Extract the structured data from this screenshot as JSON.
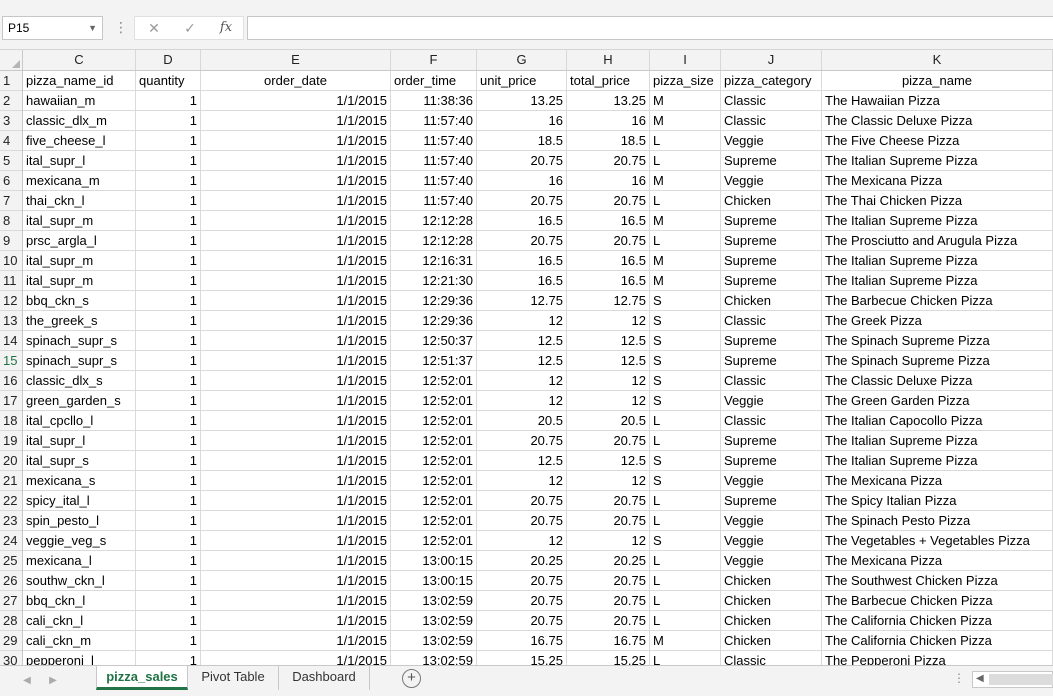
{
  "name_box": "P15",
  "formula_bar": {
    "cancel_icon": "close-icon",
    "enter_icon": "checkmark-icon",
    "function_label": "fx",
    "content": ""
  },
  "columns": [
    "C",
    "D",
    "E",
    "F",
    "G",
    "H",
    "I",
    "J",
    "K"
  ],
  "headers": [
    "pizza_name_id",
    "quantity",
    "order_date",
    "order_time",
    "unit_price",
    "total_price",
    "pizza_size",
    "pizza_category",
    "pizza_name"
  ],
  "selected_row": 15,
  "rows": [
    {
      "n": "2",
      "cells": [
        "hawaiian_m",
        "1",
        "1/1/2015",
        "11:38:36",
        "13.25",
        "13.25",
        "M",
        "Classic",
        "The Hawaiian Pizza"
      ]
    },
    {
      "n": "3",
      "cells": [
        "classic_dlx_m",
        "1",
        "1/1/2015",
        "11:57:40",
        "16",
        "16",
        "M",
        "Classic",
        "The Classic Deluxe Pizza"
      ]
    },
    {
      "n": "4",
      "cells": [
        "five_cheese_l",
        "1",
        "1/1/2015",
        "11:57:40",
        "18.5",
        "18.5",
        "L",
        "Veggie",
        "The Five Cheese Pizza"
      ]
    },
    {
      "n": "5",
      "cells": [
        "ital_supr_l",
        "1",
        "1/1/2015",
        "11:57:40",
        "20.75",
        "20.75",
        "L",
        "Supreme",
        "The Italian Supreme Pizza"
      ]
    },
    {
      "n": "6",
      "cells": [
        "mexicana_m",
        "1",
        "1/1/2015",
        "11:57:40",
        "16",
        "16",
        "M",
        "Veggie",
        "The Mexicana Pizza"
      ]
    },
    {
      "n": "7",
      "cells": [
        "thai_ckn_l",
        "1",
        "1/1/2015",
        "11:57:40",
        "20.75",
        "20.75",
        "L",
        "Chicken",
        "The Thai Chicken Pizza"
      ]
    },
    {
      "n": "8",
      "cells": [
        "ital_supr_m",
        "1",
        "1/1/2015",
        "12:12:28",
        "16.5",
        "16.5",
        "M",
        "Supreme",
        "The Italian Supreme Pizza"
      ]
    },
    {
      "n": "9",
      "cells": [
        "prsc_argla_l",
        "1",
        "1/1/2015",
        "12:12:28",
        "20.75",
        "20.75",
        "L",
        "Supreme",
        "The Prosciutto and Arugula Pizza"
      ]
    },
    {
      "n": "10",
      "cells": [
        "ital_supr_m",
        "1",
        "1/1/2015",
        "12:16:31",
        "16.5",
        "16.5",
        "M",
        "Supreme",
        "The Italian Supreme Pizza"
      ]
    },
    {
      "n": "11",
      "cells": [
        "ital_supr_m",
        "1",
        "1/1/2015",
        "12:21:30",
        "16.5",
        "16.5",
        "M",
        "Supreme",
        "The Italian Supreme Pizza"
      ]
    },
    {
      "n": "12",
      "cells": [
        "bbq_ckn_s",
        "1",
        "1/1/2015",
        "12:29:36",
        "12.75",
        "12.75",
        "S",
        "Chicken",
        "The Barbecue Chicken Pizza"
      ]
    },
    {
      "n": "13",
      "cells": [
        "the_greek_s",
        "1",
        "1/1/2015",
        "12:29:36",
        "12",
        "12",
        "S",
        "Classic",
        "The Greek Pizza"
      ]
    },
    {
      "n": "14",
      "cells": [
        "spinach_supr_s",
        "1",
        "1/1/2015",
        "12:50:37",
        "12.5",
        "12.5",
        "S",
        "Supreme",
        "The Spinach Supreme Pizza"
      ]
    },
    {
      "n": "15",
      "cells": [
        "spinach_supr_s",
        "1",
        "1/1/2015",
        "12:51:37",
        "12.5",
        "12.5",
        "S",
        "Supreme",
        "The Spinach Supreme Pizza"
      ]
    },
    {
      "n": "16",
      "cells": [
        "classic_dlx_s",
        "1",
        "1/1/2015",
        "12:52:01",
        "12",
        "12",
        "S",
        "Classic",
        "The Classic Deluxe Pizza"
      ]
    },
    {
      "n": "17",
      "cells": [
        "green_garden_s",
        "1",
        "1/1/2015",
        "12:52:01",
        "12",
        "12",
        "S",
        "Veggie",
        "The Green Garden Pizza"
      ]
    },
    {
      "n": "18",
      "cells": [
        "ital_cpcllo_l",
        "1",
        "1/1/2015",
        "12:52:01",
        "20.5",
        "20.5",
        "L",
        "Classic",
        "The Italian Capocollo Pizza"
      ]
    },
    {
      "n": "19",
      "cells": [
        "ital_supr_l",
        "1",
        "1/1/2015",
        "12:52:01",
        "20.75",
        "20.75",
        "L",
        "Supreme",
        "The Italian Supreme Pizza"
      ]
    },
    {
      "n": "20",
      "cells": [
        "ital_supr_s",
        "1",
        "1/1/2015",
        "12:52:01",
        "12.5",
        "12.5",
        "S",
        "Supreme",
        "The Italian Supreme Pizza"
      ]
    },
    {
      "n": "21",
      "cells": [
        "mexicana_s",
        "1",
        "1/1/2015",
        "12:52:01",
        "12",
        "12",
        "S",
        "Veggie",
        "The Mexicana Pizza"
      ]
    },
    {
      "n": "22",
      "cells": [
        "spicy_ital_l",
        "1",
        "1/1/2015",
        "12:52:01",
        "20.75",
        "20.75",
        "L",
        "Supreme",
        "The Spicy Italian Pizza"
      ]
    },
    {
      "n": "23",
      "cells": [
        "spin_pesto_l",
        "1",
        "1/1/2015",
        "12:52:01",
        "20.75",
        "20.75",
        "L",
        "Veggie",
        "The Spinach Pesto Pizza"
      ]
    },
    {
      "n": "24",
      "cells": [
        "veggie_veg_s",
        "1",
        "1/1/2015",
        "12:52:01",
        "12",
        "12",
        "S",
        "Veggie",
        "The Vegetables + Vegetables Pizza"
      ]
    },
    {
      "n": "25",
      "cells": [
        "mexicana_l",
        "1",
        "1/1/2015",
        "13:00:15",
        "20.25",
        "20.25",
        "L",
        "Veggie",
        "The Mexicana Pizza"
      ]
    },
    {
      "n": "26",
      "cells": [
        "southw_ckn_l",
        "1",
        "1/1/2015",
        "13:00:15",
        "20.75",
        "20.75",
        "L",
        "Chicken",
        "The Southwest Chicken Pizza"
      ]
    },
    {
      "n": "27",
      "cells": [
        "bbq_ckn_l",
        "1",
        "1/1/2015",
        "13:02:59",
        "20.75",
        "20.75",
        "L",
        "Chicken",
        "The Barbecue Chicken Pizza"
      ]
    },
    {
      "n": "28",
      "cells": [
        "cali_ckn_l",
        "1",
        "1/1/2015",
        "13:02:59",
        "20.75",
        "20.75",
        "L",
        "Chicken",
        "The California Chicken Pizza"
      ]
    },
    {
      "n": "29",
      "cells": [
        "cali_ckn_m",
        "1",
        "1/1/2015",
        "13:02:59",
        "16.75",
        "16.75",
        "M",
        "Chicken",
        "The California Chicken Pizza"
      ]
    },
    {
      "n": "30",
      "cells": [
        "pepperoni_l",
        "1",
        "1/1/2015",
        "13:02:59",
        "15.25",
        "15.25",
        "L",
        "Classic",
        "The Pepperoni Pizza"
      ]
    }
  ],
  "sheet_tabs": [
    {
      "label": "pizza_sales",
      "active": true
    },
    {
      "label": "Pivot Table",
      "active": false
    },
    {
      "label": "Dashboard",
      "active": false
    }
  ],
  "add_sheet_icon": "plus-circle-icon",
  "colors": {
    "accent": "#217346",
    "grid": "#dadada",
    "header_bg": "#f3f3f3"
  }
}
